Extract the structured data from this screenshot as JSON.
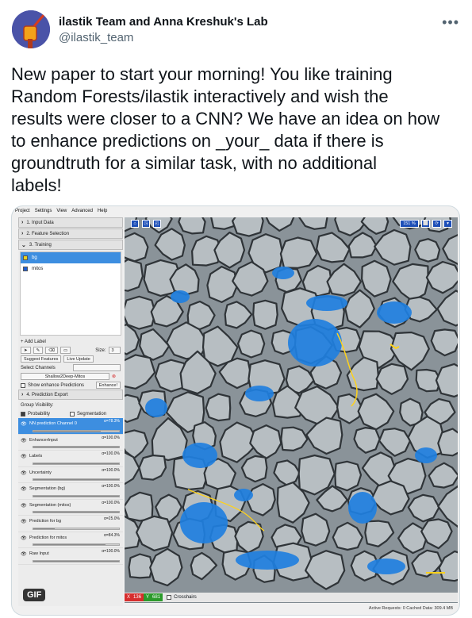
{
  "tweet": {
    "author_name": "ilastik Team and Anna Kreshuk's Lab",
    "author_handle": "@ilastik_team",
    "more_icon": "more-horizontal-icon",
    "text": "New paper to start your morning! You like training\nRandom Forests/ilastik interactively and wish the\nresults were closer to a CNN? We have an idea on how\nto enhance predictions on _your_ data if there is\ngroundtruth for a similar task, with no additional\nlabels!"
  },
  "media": {
    "badge": "GIF",
    "menubar": [
      "Project",
      "Settings",
      "View",
      "Advanced",
      "Help"
    ],
    "applets": {
      "input": "1. Input Data",
      "features": "2. Feature Selection",
      "training": "3. Training",
      "export": "4. Prediction Export"
    },
    "labels": [
      {
        "name": "bg",
        "color": "#e8d21e"
      },
      {
        "name": "mitos",
        "color": "#1e5fd6"
      }
    ],
    "add_label": "+ Add Label",
    "brush_size_label": "Size:",
    "brush_size_value": "3",
    "suggest_features": "Suggest Features",
    "live_update": "Live Update",
    "select_channels": "Select Channels",
    "model_name": "Shallow2Deep-Mitos",
    "show_enhance": "Show enhance Predictions",
    "enhance_button": "Enhance!",
    "group_visibility": "Group Visibility:",
    "probability": "Probability",
    "segmentation": "Segmentation",
    "layers": [
      {
        "name": "NN prediction Channel 0",
        "alpha": "α=78.3%",
        "fill": 0.783
      },
      {
        "name": "EnhancerInput",
        "alpha": "α=100.0%",
        "fill": 1.0
      },
      {
        "name": "Labels",
        "alpha": "α=100.0%",
        "fill": 1.0
      },
      {
        "name": "Uncertainty",
        "alpha": "α=100.0%",
        "fill": 1.0
      },
      {
        "name": "Segmentation (bg)",
        "alpha": "α=100.0%",
        "fill": 1.0
      },
      {
        "name": "Segmentation (mitos)",
        "alpha": "α=100.0%",
        "fill": 1.0
      },
      {
        "name": "Prediction for bg",
        "alpha": "α=25.0%",
        "fill": 0.25
      },
      {
        "name": "Prediction for mitos",
        "alpha": "α=84.3%",
        "fill": 0.843
      },
      {
        "name": "Raw Input",
        "alpha": "α=100.0%",
        "fill": 1.0
      }
    ],
    "zoom": "151 %",
    "coord_x_label": "X",
    "coord_x": "136",
    "coord_y_label": "Y",
    "coord_y": "681",
    "crosshairs": "Crosshairs",
    "active_requests": "Active Requests: 0  Cached Data: 309.4 MB",
    "colors": {
      "prediction_blue": "#1f7fe0",
      "annotation_yellow": "#ffd21a",
      "membrane": "#2f3438"
    }
  }
}
